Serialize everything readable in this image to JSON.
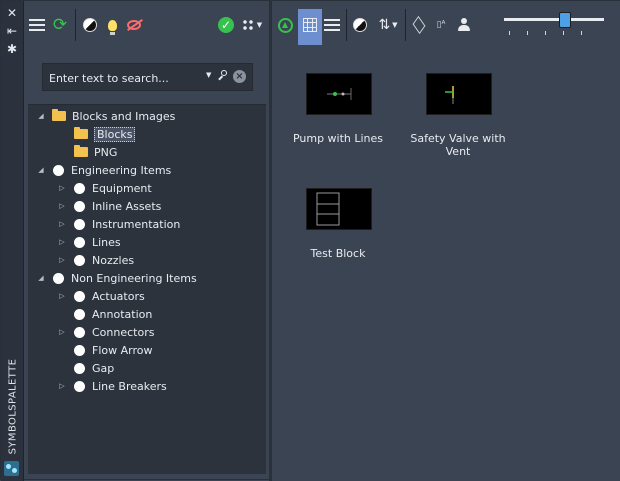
{
  "toolbar": {
    "buttons": [
      "menu-icon",
      "refresh-icon",
      "contrast-icon",
      "lightbulb-icon",
      "visibility-off-icon",
      "check-icon",
      "grid-view-icon",
      "green-triangle-icon",
      "table-view-icon",
      "list-view-icon",
      "contrast-toggle-icon",
      "sort-icon",
      "layers-icon",
      "text-symbol-icon",
      "user-icon"
    ],
    "slider_level": 0.6
  },
  "palette": {
    "vertical_label": "SYMBOLSPALETTE"
  },
  "search": {
    "placeholder": "Enter text to search..."
  },
  "tree": {
    "blocks_and_images": "Blocks and Images",
    "blocks": "Blocks",
    "png": "PNG",
    "engineering_items": "Engineering Items",
    "equipment": "Equipment",
    "inline_assets": "Inline Assets",
    "instrumentation": "Instrumentation",
    "lines": "Lines",
    "nozzles": "Nozzles",
    "non_engineering_items": "Non Engineering Items",
    "actuators": "Actuators",
    "annotation": "Annotation",
    "connectors": "Connectors",
    "flow_arrow": "Flow Arrow",
    "gap": "Gap",
    "line_breakers": "Line Breakers"
  },
  "items": {
    "pump": "Pump with Lines",
    "safety1": "Safety Valve with",
    "safety2": "Vent",
    "test": "Test Block"
  },
  "colors": {
    "accent": "#6d8fcf",
    "background": "#3b4453",
    "tree_bg": "#2d333d",
    "folder": "#f2c14e",
    "ok": "#37c24f"
  }
}
